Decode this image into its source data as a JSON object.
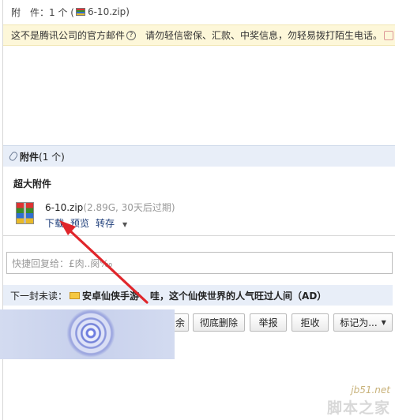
{
  "attachment_line": {
    "label": "附　件：",
    "count": "1 个 (",
    "filename": "6-10.zip)"
  },
  "warning": {
    "text": "这不是腾讯公司的官方邮件",
    "help": "?",
    "advice": "请勿轻信密保、汇款、中奖信息，勿轻易拨打陌生电话。"
  },
  "attachments": {
    "title": "附件",
    "count": "(1 个)",
    "section": "超大附件",
    "file": {
      "name": "6-10.zip",
      "meta": "(2.89G, 30天后过期)",
      "actions": [
        "下载",
        "预览",
        "转存"
      ]
    }
  },
  "quick_reply": {
    "placeholder": "快捷回复给：£肉..阕‰"
  },
  "next_mail": {
    "label": "下一封未读：",
    "sender": "安卓仙侠手游",
    "subject": "哇，这个仙侠世界的人气旺过人间（AD）"
  },
  "buttons": {
    "delete_partial": "余",
    "perm_delete": "彻底删除",
    "report": "举报",
    "reject": "拒收",
    "mark_as": "标记为..."
  },
  "watermark": {
    "url": "jb51.net",
    "name": "脚本之家"
  },
  "colors": {
    "warning_bg": "#fdf7d9",
    "panel_bg": "#e8eef8",
    "link": "#1d3d7a",
    "arrow": "#e0262b"
  }
}
